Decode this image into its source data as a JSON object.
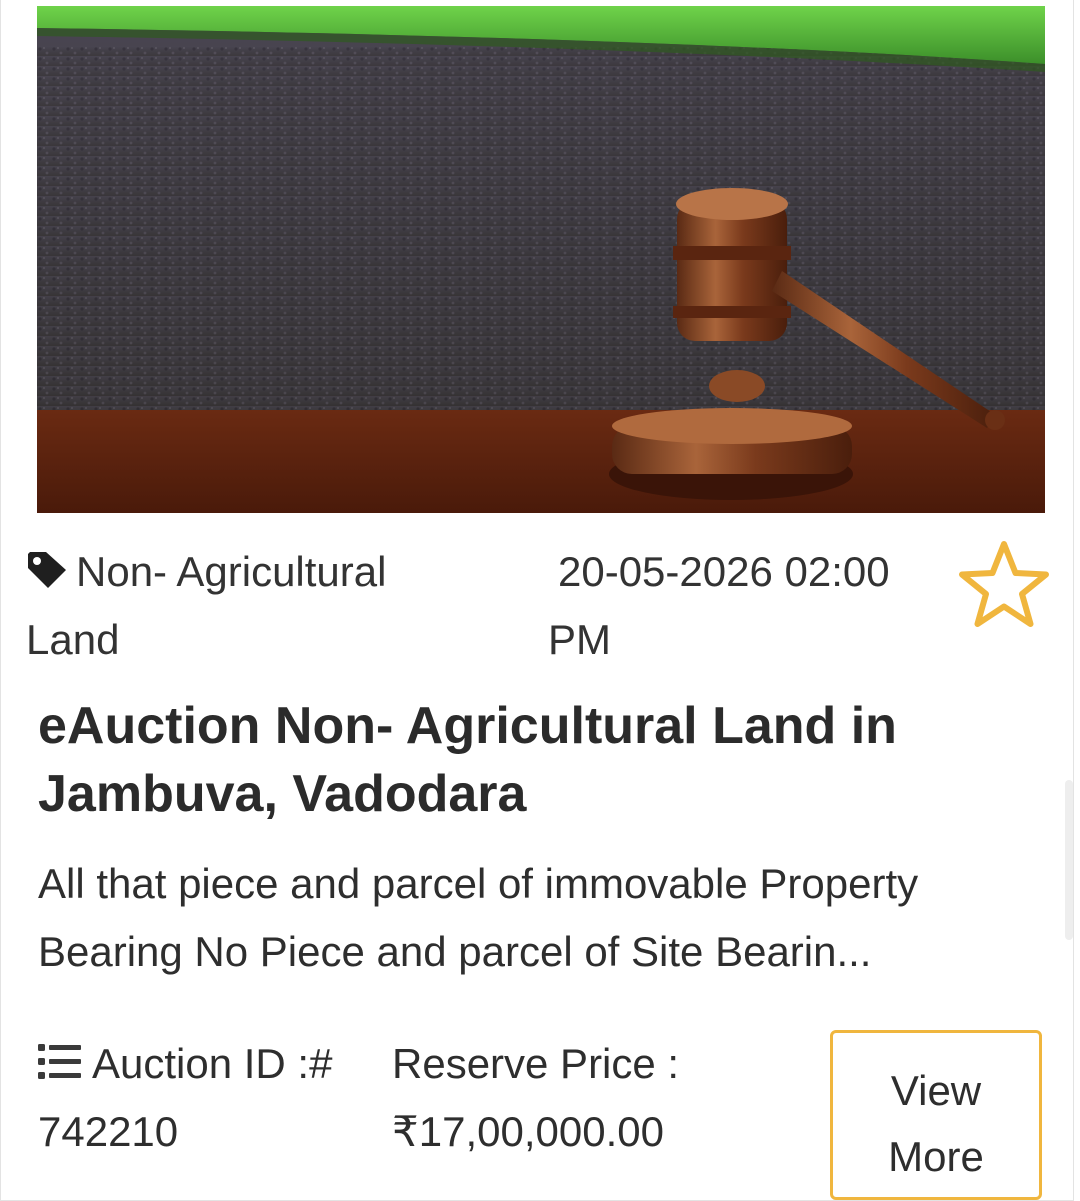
{
  "listing": {
    "image": {
      "subject": "auction gavel on land"
    },
    "category": {
      "icon": "tag-icon",
      "label": "Non- Agricultural Land"
    },
    "auction_datetime": "20-05-2026 02:00 PM",
    "favorite": {
      "icon": "star-outline-icon",
      "color": "#f0b63e"
    },
    "title": "eAuction Non- Agricultural Land in Jambuva, Vadodara",
    "description": "All that piece and parcel of immovable Property Bearing No Piece and parcel of Site Bearin...",
    "auction_id": {
      "icon": "list-icon",
      "label": "Auction ID :#",
      "value": "742210"
    },
    "reserve_price": {
      "label": "Reserve Price :",
      "value": "₹17,00,000.00"
    },
    "view_more_label": "View More"
  },
  "colors": {
    "accent": "#f0b63e",
    "text": "#2e2e2e",
    "border": "#e3e3e3"
  }
}
